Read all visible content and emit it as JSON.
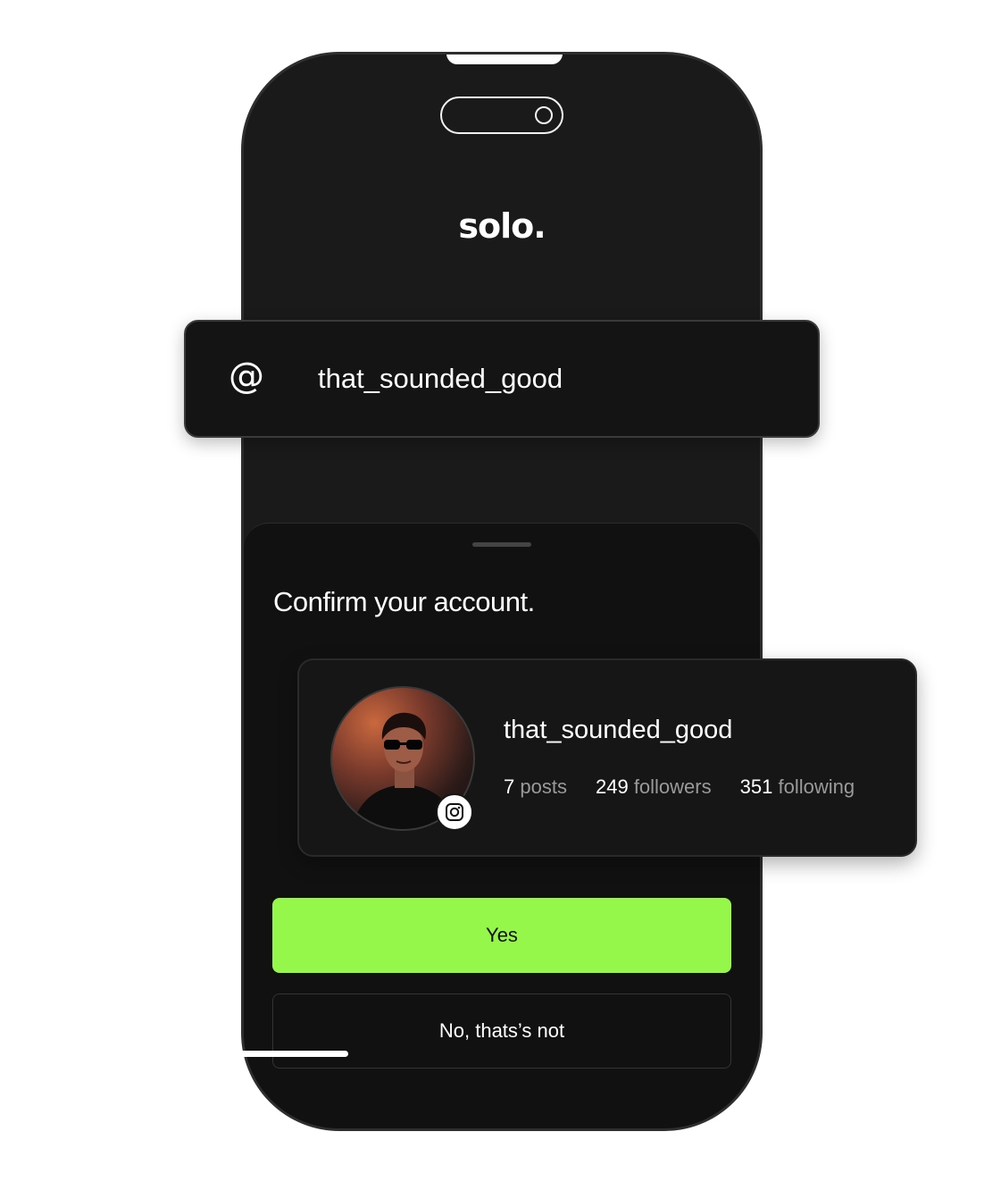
{
  "app": {
    "logo_text": "solo."
  },
  "username_field": {
    "prefix": "@",
    "value": "that_sounded_good"
  },
  "sheet": {
    "title": "Confirm your account."
  },
  "profile": {
    "username": "that_sounded_good",
    "stats": [
      {
        "number": "7",
        "label": "posts"
      },
      {
        "number": "249",
        "label": "followers"
      },
      {
        "number": "351",
        "label": "following"
      }
    ],
    "platform_icon": "instagram-icon"
  },
  "buttons": {
    "yes_label": "Yes",
    "no_label": "No, thats’s not"
  },
  "colors": {
    "accent": "#95f74a",
    "phone_bg": "#1a1a1a",
    "sheet_bg": "#111111"
  }
}
